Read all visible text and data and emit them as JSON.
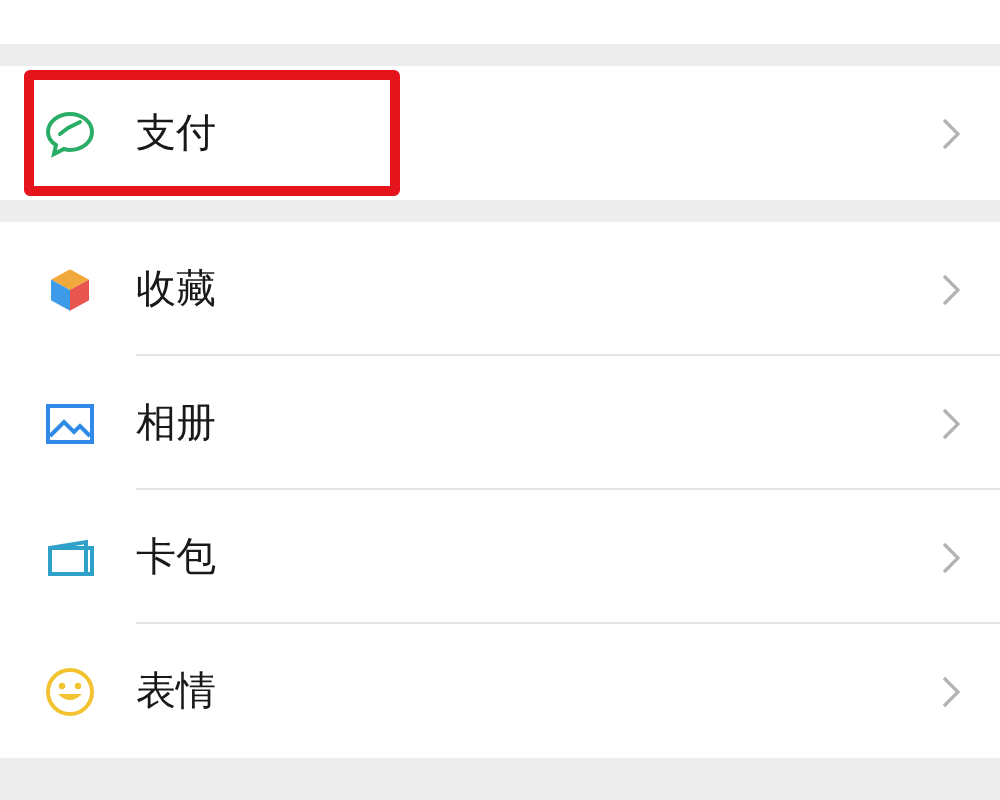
{
  "sections": [
    {
      "items": [
        {
          "label": "支付",
          "highlighted": true
        }
      ]
    },
    {
      "items": [
        {
          "label": "收藏",
          "highlighted": false
        },
        {
          "label": "相册",
          "highlighted": false
        },
        {
          "label": "卡包",
          "highlighted": false
        },
        {
          "label": "表情",
          "highlighted": false
        }
      ]
    }
  ]
}
